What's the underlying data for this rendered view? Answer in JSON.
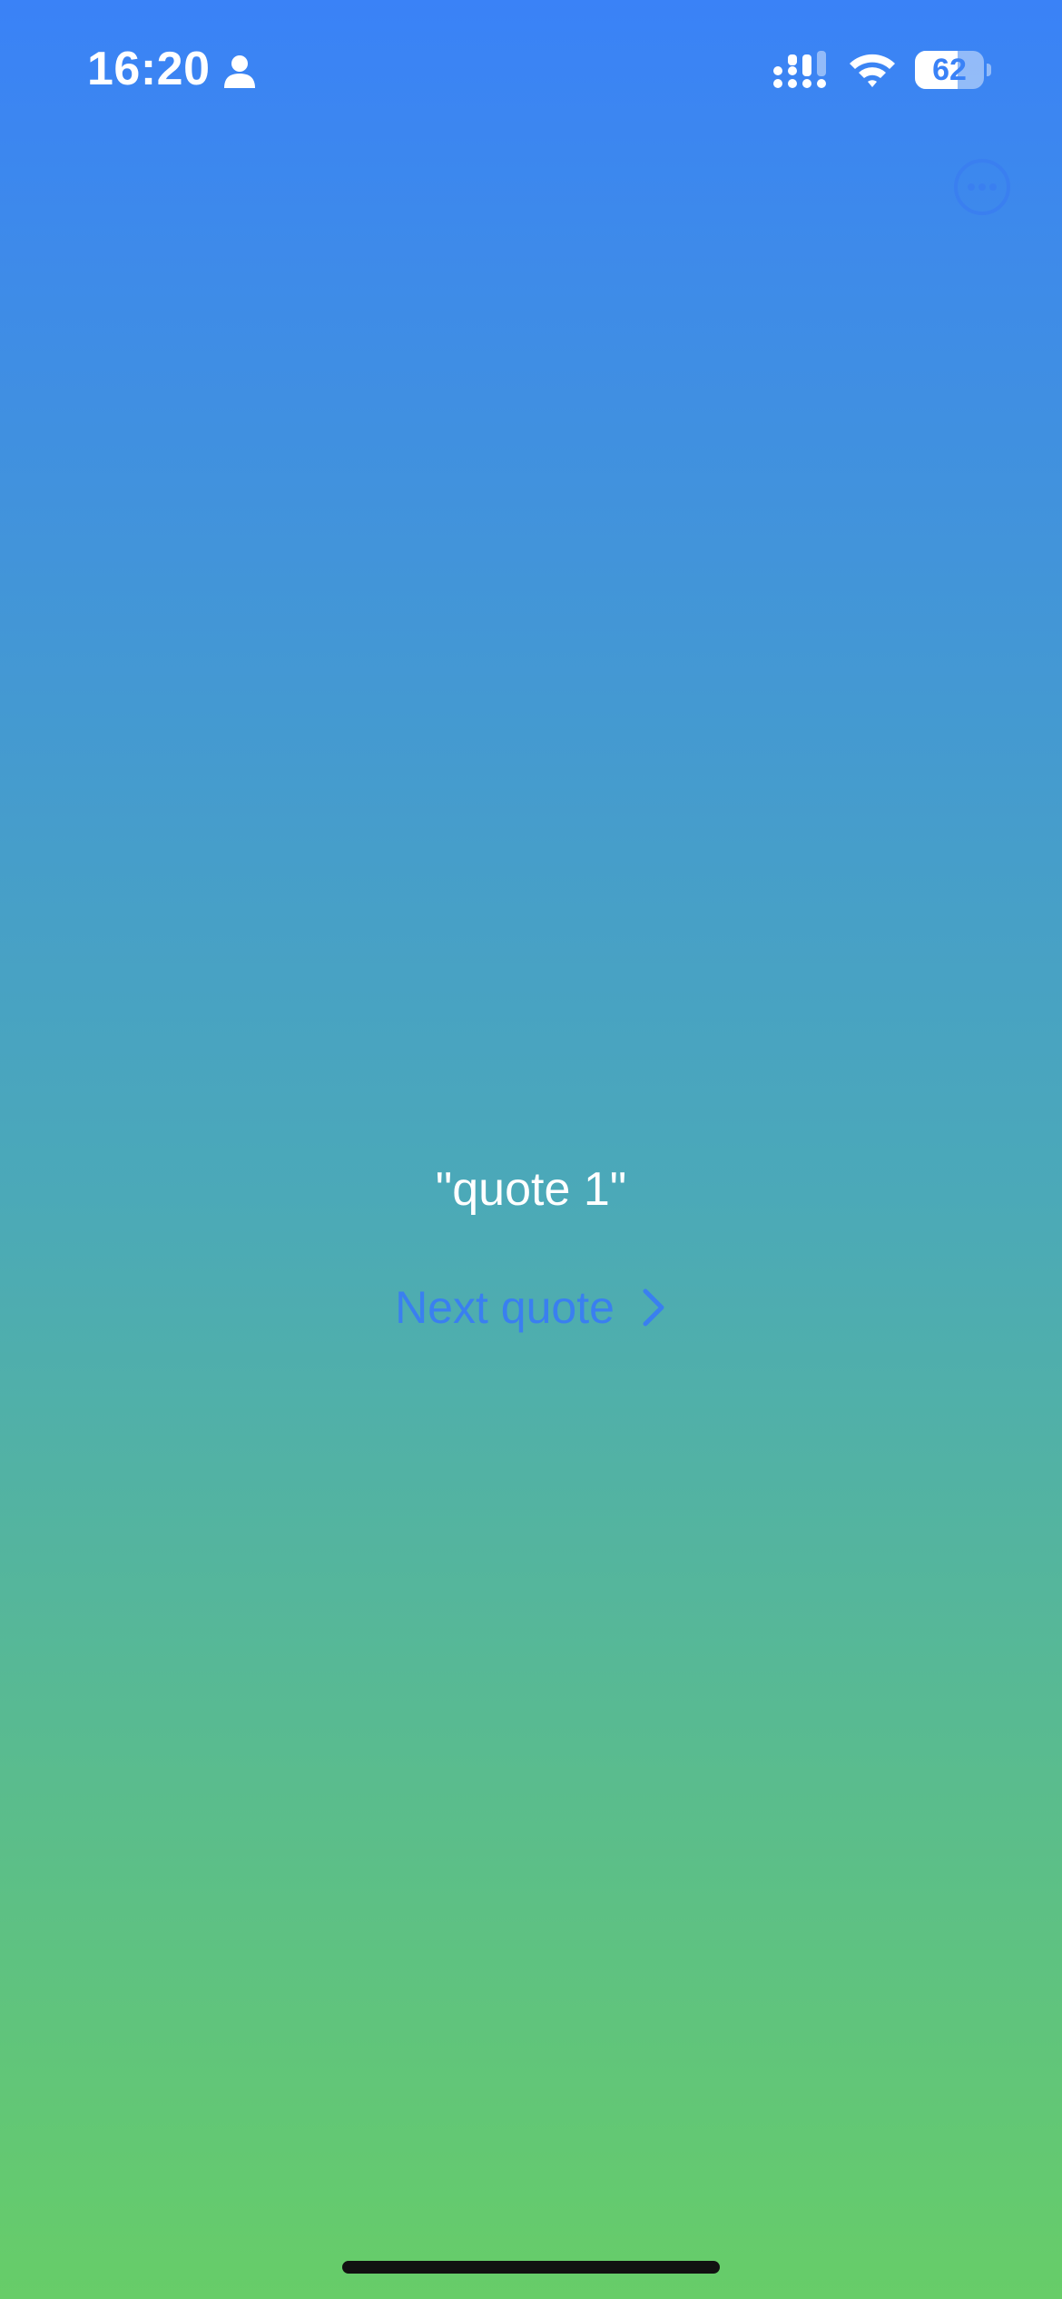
{
  "status_bar": {
    "time": "16:20",
    "battery_level": "62",
    "battery_fraction": 0.62,
    "icons": [
      "person-icon",
      "cellular-signal-icon",
      "wifi-icon",
      "battery-icon"
    ]
  },
  "header": {
    "more_icon": "ellipsis-circle-icon"
  },
  "main": {
    "quote": "\"quote 1\"",
    "next_label": "Next quote",
    "next_icon": "chevron-right-icon"
  },
  "colors": {
    "gradient_top": "#3a82f7",
    "gradient_mid": "#4ba9b8",
    "gradient_bottom": "#67cd68",
    "accent": "#3a7ff0",
    "text": "#ffffff"
  }
}
